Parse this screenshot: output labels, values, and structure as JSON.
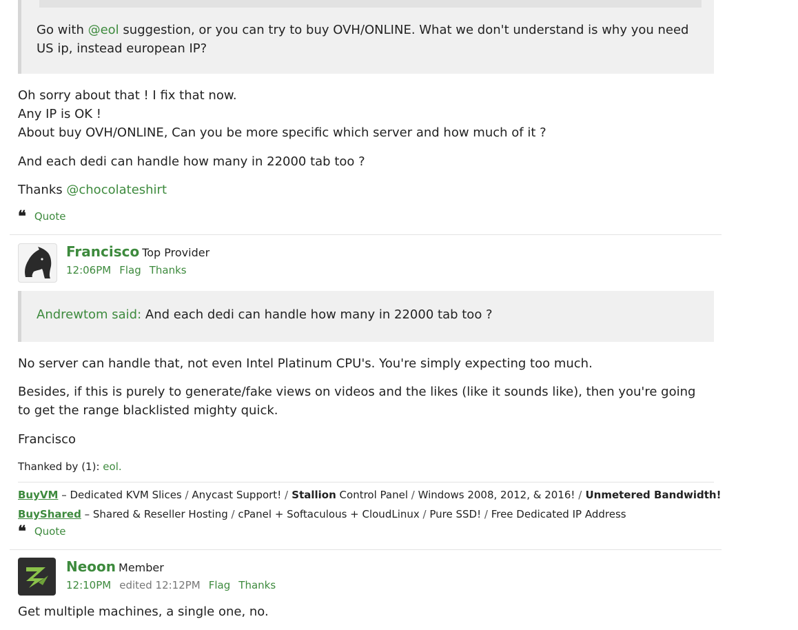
{
  "post1": {
    "quote_text_prefix": "Go with ",
    "quote_mention": "@eol",
    "quote_text_suffix": " suggestion, or you can try to buy OVH/ONLINE. What we don't understand is why you need US ip, instead european IP?",
    "lines": [
      "Oh sorry about that ! I fix that now.",
      "Any IP is OK !",
      "About buy OVH/ONLINE, Can you be more specific which server and how much of it ?"
    ],
    "para2": "And each dedi can handle how many in 22000 tab too ?",
    "thanks_prefix": "Thanks ",
    "thanks_mention": "@chocolateshirt",
    "quote_label": "Quote"
  },
  "post2": {
    "author": "Francisco",
    "role": "Top Provider",
    "time": "12:06PM",
    "flag": "Flag",
    "thanks": "Thanks",
    "quote_author": "Andrewtom said:",
    "quote_text": " And each dedi can handle how many in 22000 tab too ?",
    "p1": "No server can handle that, not even Intel Platinum CPU's. You're simply expecting too much.",
    "p2": "Besides, if this is purely to generate/fake views on videos and the likes (like it sounds like), then you're going to get the range blacklisted mighty quick.",
    "sign": "Francisco",
    "thanked_by_label": "Thanked by (1):",
    "thanked_by_user": "eol.",
    "sig1": {
      "brand": "BuyVM",
      "dash": " – Dedicated KVM Slices ",
      "s1": "/",
      "t1": " Anycast Support! ",
      "s2": "/",
      "t2b": " Stallion",
      "t2": " Control Panel ",
      "s3": "/",
      "t3": " Windows 2008, 2012, & 2016! ",
      "s4": "/",
      "t4b": " Unmetered Bandwidth!"
    },
    "sig2": {
      "brand": "BuyShared",
      "dash": " – Shared & Reseller Hosting ",
      "s1": "/",
      "t1": " cPanel + Softaculous + CloudLinux ",
      "s2": "/",
      "t2": " Pure SSD! ",
      "s3": "/",
      "t3": " Free Dedicated IP Address"
    },
    "quote_label": "Quote"
  },
  "post3": {
    "author": "Neoon",
    "role": "Member",
    "time": "12:10PM",
    "edited": "edited 12:12PM",
    "flag": "Flag",
    "thanks": "Thanks",
    "p1": "Get multiple machines, a single one, no."
  },
  "colors": {
    "link": "#3d8a3d",
    "quote_bg": "#f0f0f0",
    "neoon_icon": "#8bc34a"
  },
  "icons": {
    "quote": "quote-icon",
    "francisco_avatar": "horse-head-icon",
    "neoon_avatar": "lightning-logo-icon"
  }
}
